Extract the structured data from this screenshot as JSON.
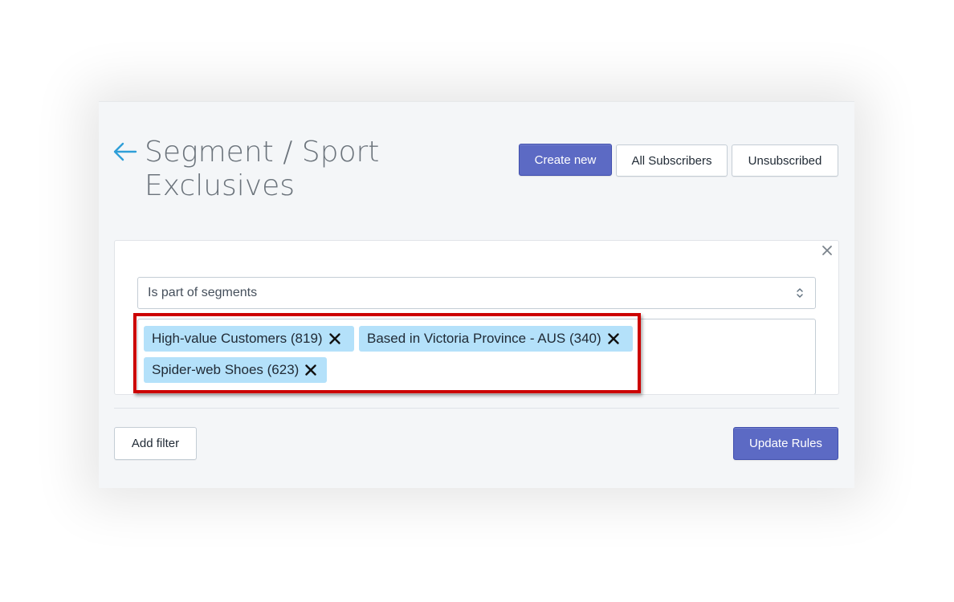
{
  "page": {
    "title": "Segment / Sport Exclusives",
    "back_icon": "arrow-left-icon"
  },
  "header_actions": {
    "create_label": "Create new",
    "all_subscribers_label": "All Subscribers",
    "unsubscribed_label": "Unsubscribed"
  },
  "filter": {
    "close_icon": "close-icon",
    "condition_selected": "Is part of segments",
    "segments": [
      {
        "label": "High-value Customers (819)"
      },
      {
        "label": "Based in Victoria Province - AUS (340)"
      },
      {
        "label": "Spider-web Shoes (623)"
      }
    ]
  },
  "footer": {
    "add_filter_label": "Add filter",
    "update_rules_label": "Update Rules"
  },
  "colors": {
    "primary": "#5c6ac4",
    "tag_background": "#b4e1fa",
    "highlight_border": "#cc0000",
    "back_arrow": "#2f9fd8"
  }
}
